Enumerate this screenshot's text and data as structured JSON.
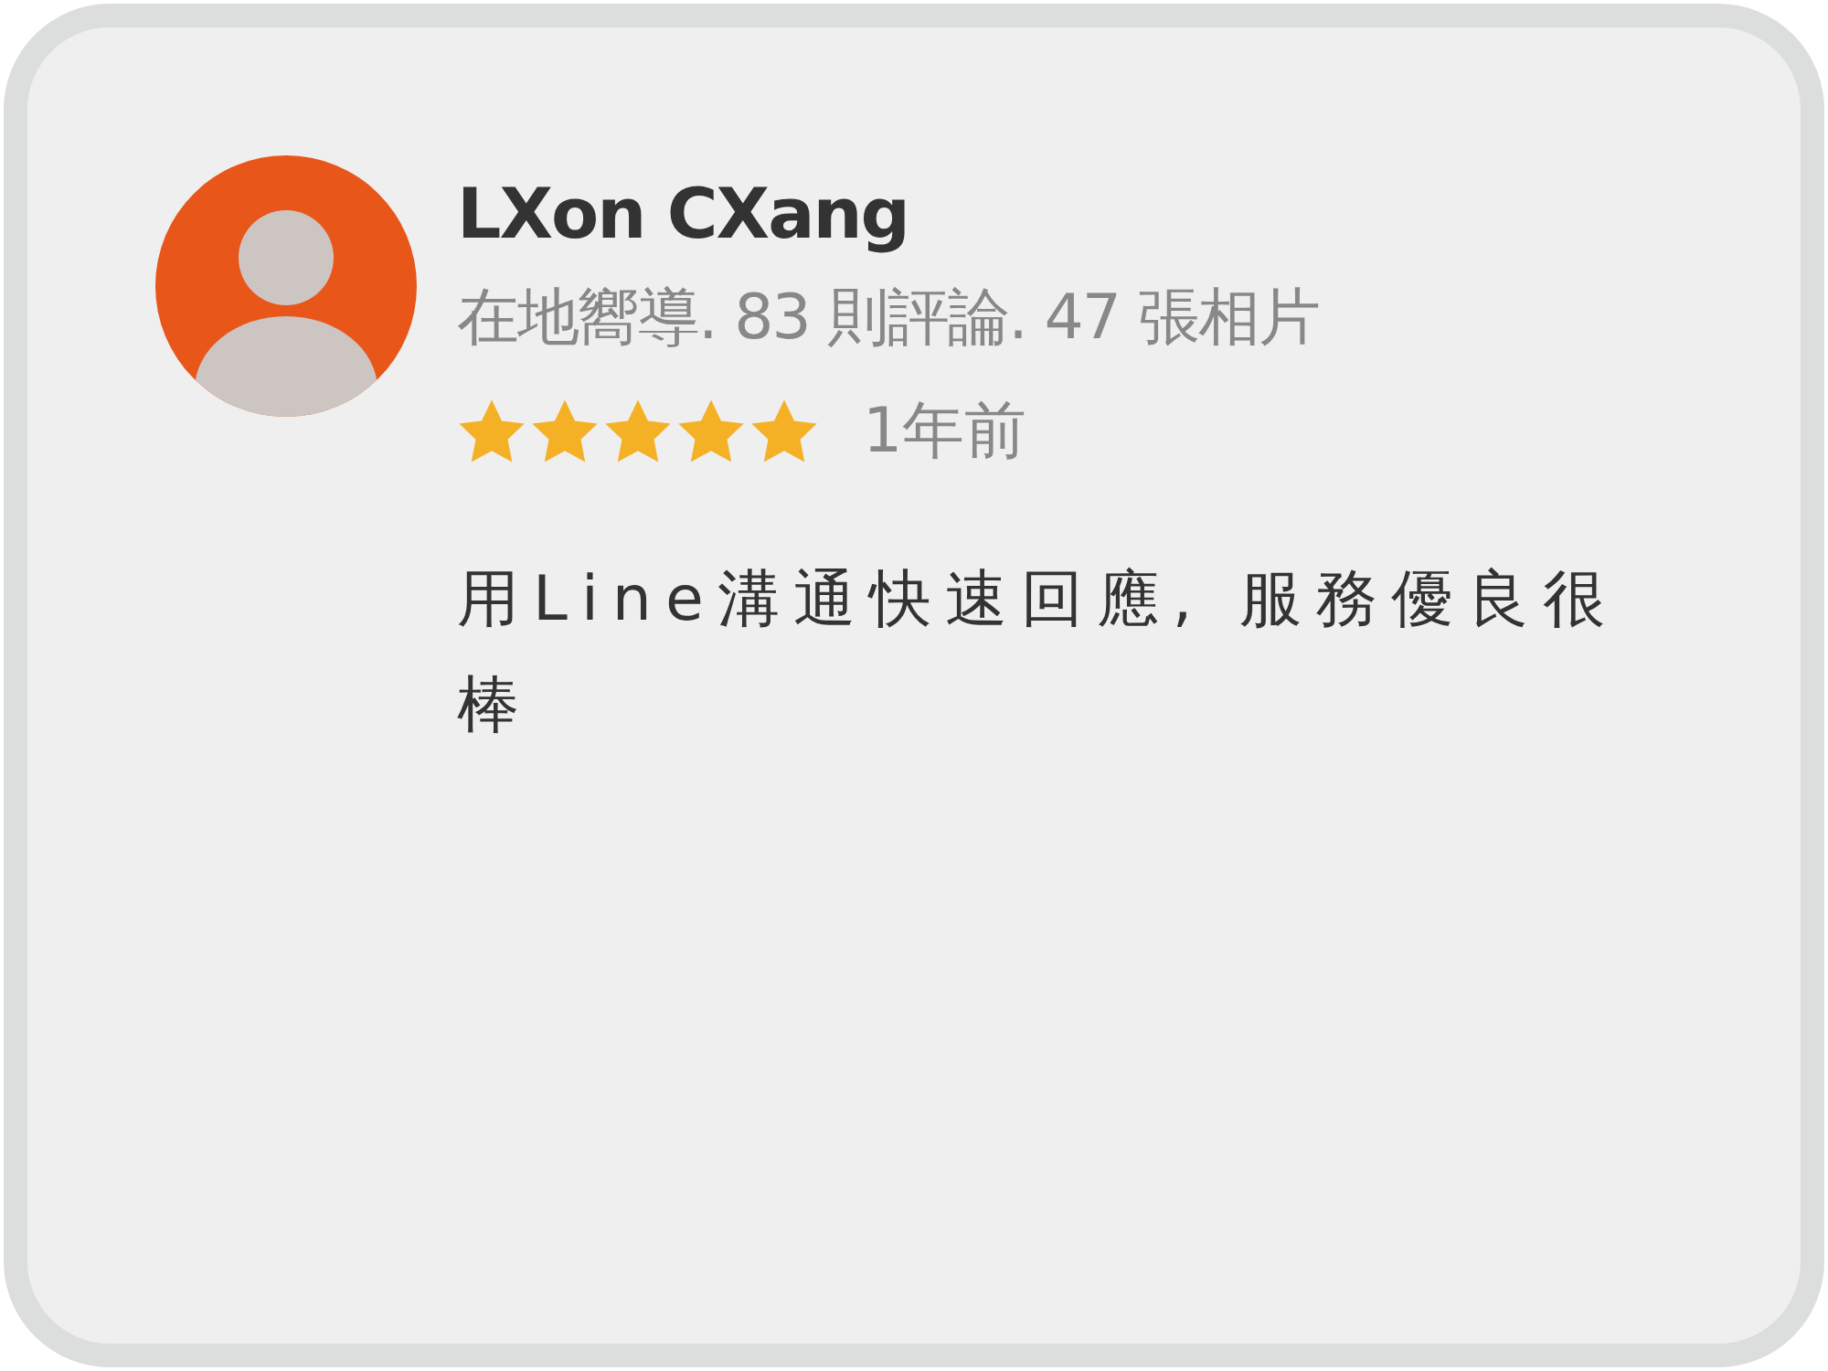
{
  "review": {
    "author": "LXon CXang",
    "meta": "在地嚮導. 83 則評論. 47 張相片",
    "stars": 5,
    "time": "1年前",
    "text": "用Line溝通快速回應, 服務優良很棒"
  }
}
